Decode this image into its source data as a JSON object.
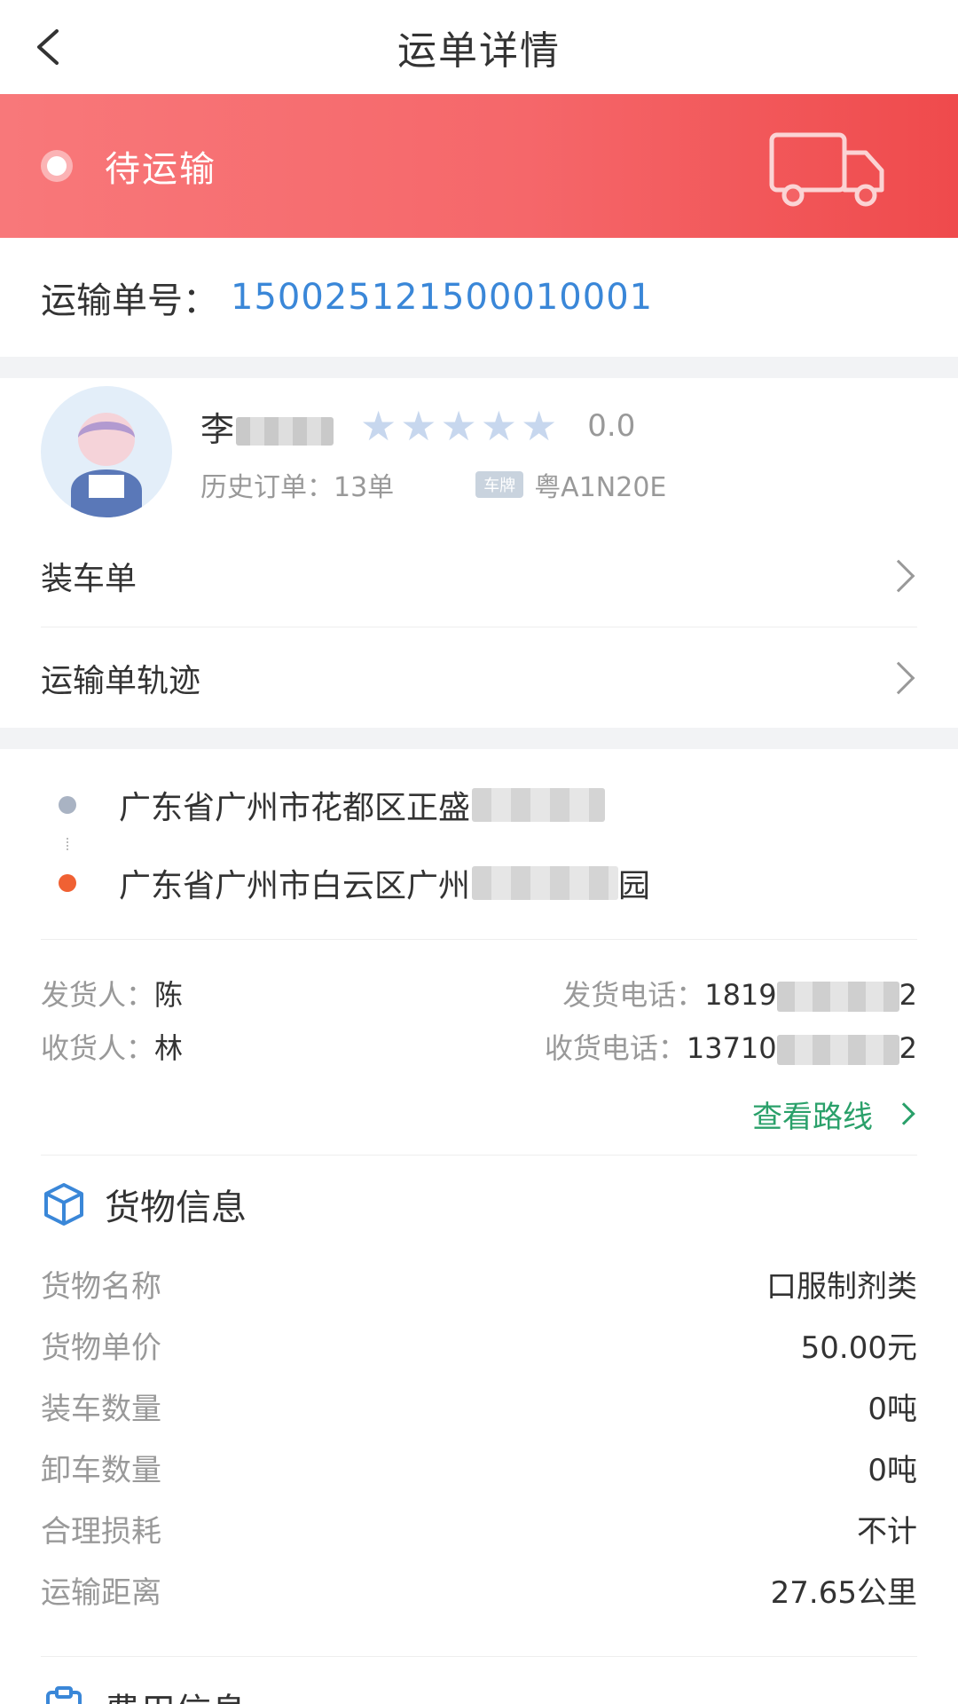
{
  "header": {
    "title": "运单详情"
  },
  "status": {
    "text": "待运输"
  },
  "order": {
    "label": "运输单号：",
    "number": "150025121500010001"
  },
  "driver": {
    "name_visible": "李",
    "rating": "0.0",
    "history_label": "历史订单：13单",
    "plate_badge": "车牌",
    "plate": "粤A1N20E",
    "star_color": "#c7d7ee"
  },
  "links": [
    {
      "label": "装车单"
    },
    {
      "label": "运输单轨迹"
    }
  ],
  "route": {
    "from_visible": "广东省广州市花都区正盛",
    "to_visible": "广东省广州市白云区广州",
    "to_suffix": "园",
    "from_dot_color": "#a9b3c3",
    "to_dot_color": "#f06133"
  },
  "contacts": {
    "shipper_label": "发货人：",
    "shipper_name": "陈",
    "shipper_phone_label": "发货电话：",
    "shipper_phone_start": "1819",
    "shipper_phone_end": "2",
    "receiver_label": "收货人：",
    "receiver_name": "林",
    "receiver_phone_label": "收货电话：",
    "receiver_phone_start": "13710",
    "receiver_phone_end": "2",
    "view_route": "查看路线"
  },
  "goods": {
    "title": "货物信息",
    "rows": [
      {
        "label": "货物名称",
        "value": "口服制剂类"
      },
      {
        "label": "货物单价",
        "value": "50.00元"
      },
      {
        "label": "装车数量",
        "value": "0吨"
      },
      {
        "label": "卸车数量",
        "value": "0吨"
      },
      {
        "label": "合理损耗",
        "value": "不计"
      },
      {
        "label": "运输距离",
        "value": "27.65公里"
      }
    ]
  },
  "fees": {
    "title": "费用信息"
  },
  "colors": {
    "accent_blue": "#3a87d8",
    "status_red": "#f5676a",
    "link_green": "#2aa06a"
  }
}
